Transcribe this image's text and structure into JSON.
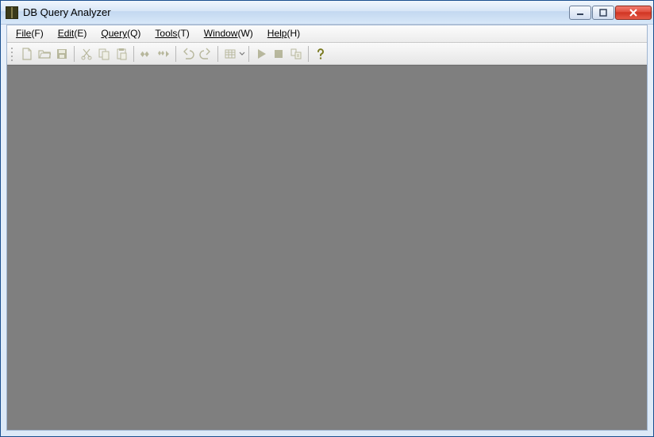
{
  "window": {
    "title": "DB Query Analyzer"
  },
  "menu": {
    "items": [
      {
        "label": "File",
        "accel": "F"
      },
      {
        "label": "Edit",
        "accel": "E"
      },
      {
        "label": "Query",
        "accel": "Q"
      },
      {
        "label": "Tools",
        "accel": "T"
      },
      {
        "label": "Window",
        "accel": "W"
      },
      {
        "label": "Help",
        "accel": "H"
      }
    ]
  },
  "toolbar": {
    "icons": {
      "new": "new-file-icon",
      "open": "open-folder-icon",
      "save": "save-icon",
      "cut": "cut-icon",
      "copy": "copy-icon",
      "paste": "paste-icon",
      "find": "find-icon",
      "findnext": "find-next-icon",
      "undo": "undo-icon",
      "redo": "redo-icon",
      "grid": "grid-icon",
      "run": "run-icon",
      "stop": "stop-icon",
      "object": "object-browser-icon",
      "help": "help-icon"
    }
  }
}
